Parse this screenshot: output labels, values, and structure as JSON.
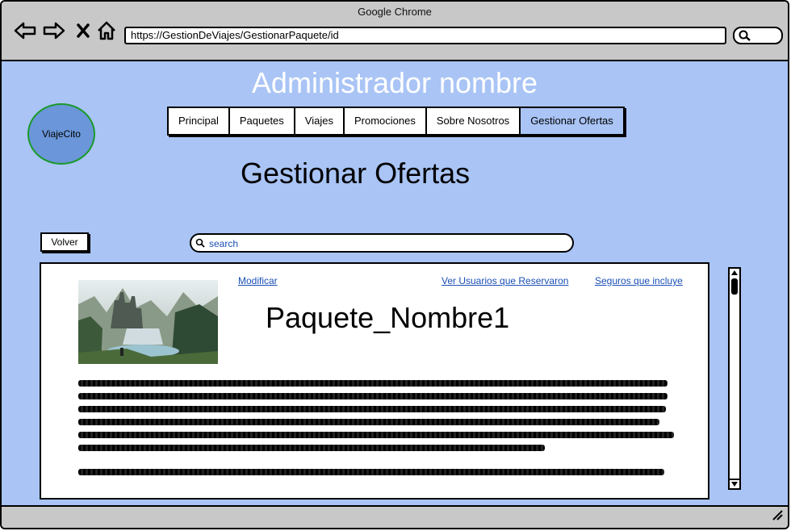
{
  "browser": {
    "title": "Google Chrome",
    "url": "https://GestionDeViajes/GestionarPaquete/id",
    "icons": [
      "back-icon",
      "forward-icon",
      "close-icon",
      "home-icon",
      "search-icon"
    ]
  },
  "header": {
    "admin_title": "Administrador nombre",
    "logo_text": "ViajeCito"
  },
  "nav": {
    "tabs": [
      {
        "label": "Principal",
        "active": false
      },
      {
        "label": "Paquetes",
        "active": false
      },
      {
        "label": "Viajes",
        "active": false
      },
      {
        "label": "Promociones",
        "active": false
      },
      {
        "label": "Sobre Nosotros",
        "active": false
      },
      {
        "label": "Gestionar Ofertas",
        "active": true
      }
    ]
  },
  "page": {
    "heading": "Gestionar Ofertas",
    "back_label": "Volver",
    "search_placeholder": "search"
  },
  "package": {
    "name": "Paquete_Nombre1",
    "modify_link": "Modificar",
    "users_link": "Ver Usuarios que Reservaron",
    "insurance_link": "Seguros que incluye"
  },
  "colors": {
    "background": "#a9c4f5",
    "active_tab": "#a9c4f5",
    "link": "#1a4fb6",
    "logo_fill": "#6b96d9",
    "logo_border": "#1a9a2a"
  }
}
